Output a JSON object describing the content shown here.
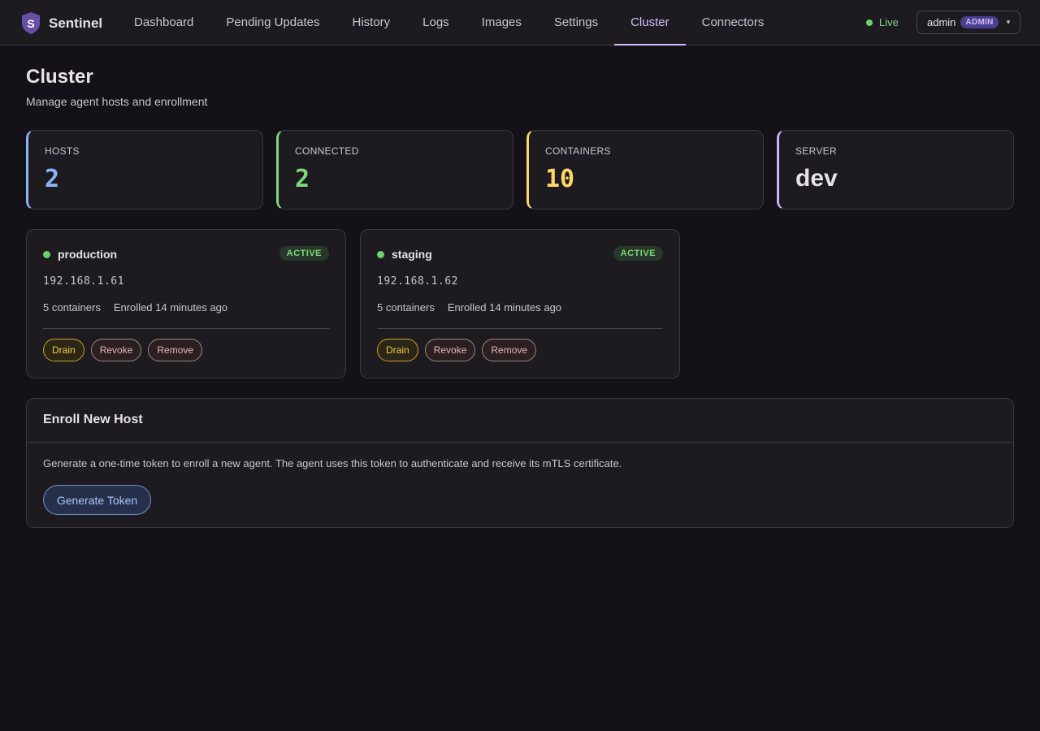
{
  "app": {
    "name": "Sentinel"
  },
  "colors": {
    "accent": "#d0bcff",
    "hosts": "#8ab4f8",
    "connected": "#7dd87a",
    "containers": "#fdd663",
    "server": "#c8b5f5"
  },
  "nav": {
    "items": [
      {
        "label": "Dashboard"
      },
      {
        "label": "Pending Updates"
      },
      {
        "label": "History"
      },
      {
        "label": "Logs"
      },
      {
        "label": "Images"
      },
      {
        "label": "Settings"
      },
      {
        "label": "Cluster",
        "active": true
      },
      {
        "label": "Connectors"
      }
    ],
    "live_label": "Live",
    "user": {
      "name": "admin",
      "role": "ADMIN",
      "caret": "▾"
    }
  },
  "page": {
    "title": "Cluster",
    "subtitle": "Manage agent hosts and enrollment"
  },
  "stats": [
    {
      "label": "HOSTS",
      "value": "2"
    },
    {
      "label": "CONNECTED",
      "value": "2"
    },
    {
      "label": "CONTAINERS",
      "value": "10"
    },
    {
      "label": "SERVER",
      "value": "dev"
    }
  ],
  "hosts": [
    {
      "name": "production",
      "status": "ACTIVE",
      "ip": "192.168.1.61",
      "containers": "5 containers",
      "enrolled": "Enrolled 14 minutes ago",
      "actions": {
        "drain": "Drain",
        "revoke": "Revoke",
        "remove": "Remove"
      }
    },
    {
      "name": "staging",
      "status": "ACTIVE",
      "ip": "192.168.1.62",
      "containers": "5 containers",
      "enrolled": "Enrolled 14 minutes ago",
      "actions": {
        "drain": "Drain",
        "revoke": "Revoke",
        "remove": "Remove"
      }
    }
  ],
  "enroll": {
    "title": "Enroll New Host",
    "description": "Generate a one-time token to enroll a new agent. The agent uses this token to authenticate and receive its mTLS certificate.",
    "button_label": "Generate Token"
  }
}
